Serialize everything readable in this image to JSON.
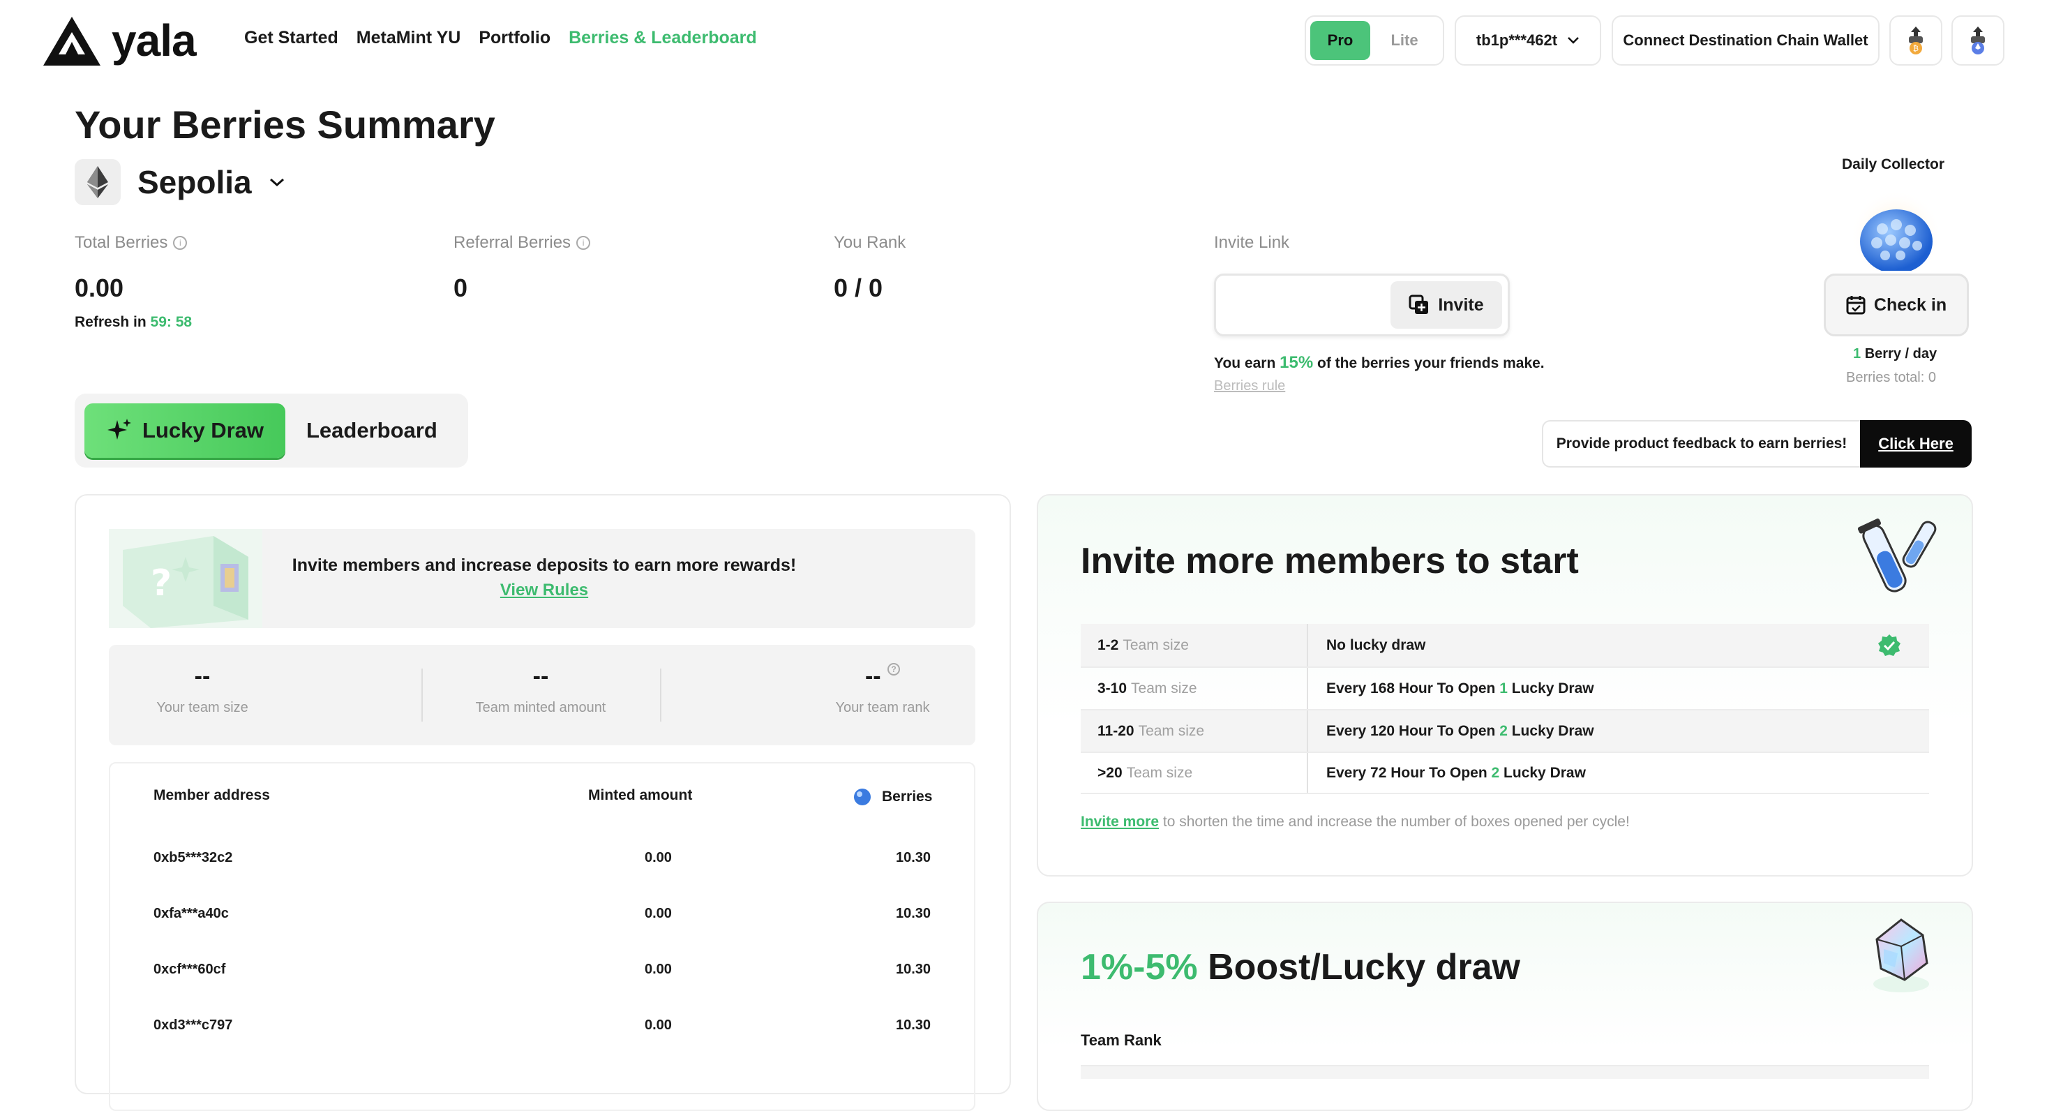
{
  "header": {
    "brand": "yala",
    "nav": [
      "Get Started",
      "MetaMint YU",
      "Portfolio",
      "Berries & Leaderboard"
    ],
    "mode": {
      "pro": "Pro",
      "lite": "Lite"
    },
    "wallet": "tb1p***462t",
    "connect_label": "Connect Destination Chain Wallet"
  },
  "summary": {
    "title": "Your Berries Summary",
    "chain": "Sepolia",
    "total_label": "Total Berries",
    "total_value": "0.00",
    "refresh_prefix": "Refresh in",
    "refresh_time": "59: 58",
    "referral_label": "Referral Berries",
    "referral_value": "0",
    "rank_label": "You Rank",
    "rank_value": "0 / 0",
    "invite_label": "Invite Link",
    "invite_button": "Invite",
    "earn_prefix": "You earn",
    "earn_pct": "15%",
    "earn_suffix": "of the berries your friends make.",
    "rules_link": "Berries rule"
  },
  "collector": {
    "title": "Daily Collector",
    "checkin": "Check in",
    "per_day_num": "1",
    "per_day_text": "Berry / day",
    "total": "Berries total: 0"
  },
  "tabs": {
    "lucky": "Lucky Draw",
    "leaderboard": "Leaderboard"
  },
  "feedback": {
    "text": "Provide product feedback to earn berries!",
    "button": "Click Here"
  },
  "lucky_panel": {
    "banner_text": "Invite members and increase deposits to earn more rewards!",
    "banner_link": "View Rules",
    "stats": [
      {
        "value": "--",
        "label": "Your team size"
      },
      {
        "value": "--",
        "label": "Team minted amount"
      },
      {
        "value": "--",
        "label": "Your team rank"
      }
    ],
    "columns": [
      "Member address",
      "Minted amount",
      "Berries"
    ],
    "members": [
      {
        "address": "0xb5***32c2",
        "minted": "0.00",
        "berries": "10.30"
      },
      {
        "address": "0xfa***a40c",
        "minted": "0.00",
        "berries": "10.30"
      },
      {
        "address": "0xcf***60cf",
        "minted": "0.00",
        "berries": "10.30"
      },
      {
        "address": "0xd3***c797",
        "minted": "0.00",
        "berries": "10.30"
      }
    ]
  },
  "invite_panel": {
    "title": "Invite more members to start",
    "tiers": [
      {
        "range": "1-2",
        "unit": "Team size",
        "pre": "No lucky draw",
        "num": "",
        "post": ""
      },
      {
        "range": "3-10",
        "unit": "Team size",
        "pre": "Every 168 Hour To Open",
        "num": "1",
        "post": "Lucky Draw"
      },
      {
        "range": "11-20",
        "unit": "Team size",
        "pre": "Every 120 Hour To Open",
        "num": "2",
        "post": "Lucky Draw"
      },
      {
        "range": ">20",
        "unit": "Team size",
        "pre": "Every 72 Hour To Open",
        "num": "2",
        "post": "Lucky Draw"
      }
    ],
    "invite_more_link": "Invite more",
    "invite_more_text": "to shorten the time and increase the number of boxes opened per cycle!"
  },
  "boost_panel": {
    "title_accent": "1%-5%",
    "title_rest": "Boost/Lucky draw",
    "team_rank": "Team Rank"
  },
  "colors": {
    "accent": "#3dbb6f",
    "dark": "#0c0c0c"
  }
}
